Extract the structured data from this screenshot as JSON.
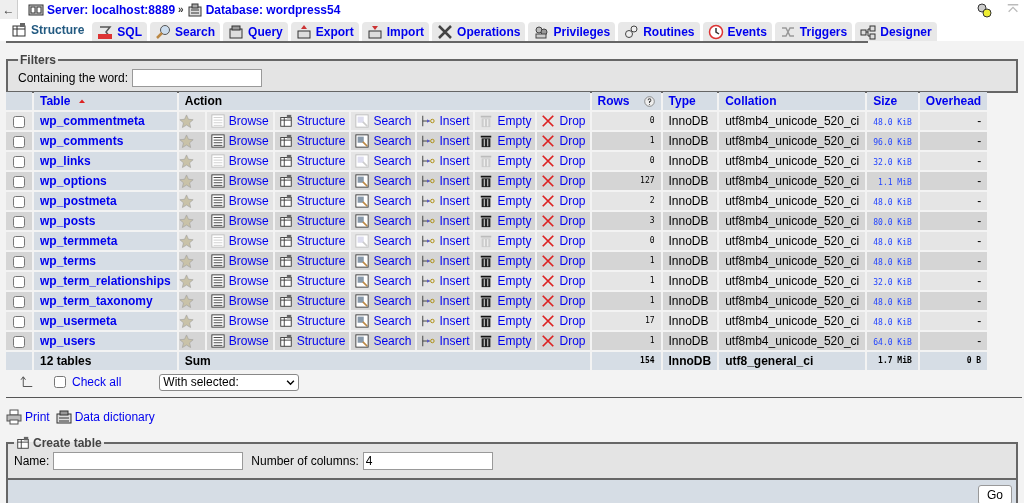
{
  "breadcrumb": [
    {
      "kind": "server",
      "label": "Server: localhost:8889"
    },
    {
      "kind": "database",
      "label": "Database: wordpress54"
    }
  ],
  "breadcrumb_separator": "»",
  "back_button": "←",
  "tabs": [
    {
      "label": "Structure",
      "selected": true
    },
    {
      "label": "SQL",
      "selected": false
    },
    {
      "label": "Search",
      "selected": false
    },
    {
      "label": "Query",
      "selected": false
    },
    {
      "label": "Export",
      "selected": false
    },
    {
      "label": "Import",
      "selected": false
    },
    {
      "label": "Operations",
      "selected": false
    },
    {
      "label": "Privileges",
      "selected": false
    },
    {
      "label": "Routines",
      "selected": false
    },
    {
      "label": "Events",
      "selected": false
    },
    {
      "label": "Triggers",
      "selected": false
    },
    {
      "label": "Designer",
      "selected": false
    }
  ],
  "filters": {
    "legend": "Filters",
    "label": "Containing the word:"
  },
  "table": {
    "columns": [
      "Table",
      "Action",
      "Rows",
      "Type",
      "Collation",
      "Size",
      "Overhead"
    ],
    "rows": [
      {
        "name": "wp_commentmeta",
        "checked": false,
        "has_rows": false,
        "actions": [
          "Browse",
          "Structure",
          "Search",
          "Insert",
          "Empty",
          "Drop"
        ],
        "rows": "0",
        "type": "InnoDB",
        "collation": "utf8mb4_unicode_520_ci",
        "size": "48.0 KiB",
        "overhead": "-"
      },
      {
        "name": "wp_comments",
        "checked": false,
        "has_rows": true,
        "actions": [
          "Browse",
          "Structure",
          "Search",
          "Insert",
          "Empty",
          "Drop"
        ],
        "rows": "1",
        "type": "InnoDB",
        "collation": "utf8mb4_unicode_520_ci",
        "size": "96.0 KiB",
        "overhead": "-"
      },
      {
        "name": "wp_links",
        "checked": false,
        "has_rows": false,
        "actions": [
          "Browse",
          "Structure",
          "Search",
          "Insert",
          "Empty",
          "Drop"
        ],
        "rows": "0",
        "type": "InnoDB",
        "collation": "utf8mb4_unicode_520_ci",
        "size": "32.0 KiB",
        "overhead": "-"
      },
      {
        "name": "wp_options",
        "checked": false,
        "has_rows": true,
        "actions": [
          "Browse",
          "Structure",
          "Search",
          "Insert",
          "Empty",
          "Drop"
        ],
        "rows": "127",
        "type": "InnoDB",
        "collation": "utf8mb4_unicode_520_ci",
        "size": "1.1 MiB",
        "overhead": "-"
      },
      {
        "name": "wp_postmeta",
        "checked": false,
        "has_rows": true,
        "actions": [
          "Browse",
          "Structure",
          "Search",
          "Insert",
          "Empty",
          "Drop"
        ],
        "rows": "2",
        "type": "InnoDB",
        "collation": "utf8mb4_unicode_520_ci",
        "size": "48.0 KiB",
        "overhead": "-"
      },
      {
        "name": "wp_posts",
        "checked": false,
        "has_rows": true,
        "actions": [
          "Browse",
          "Structure",
          "Search",
          "Insert",
          "Empty",
          "Drop"
        ],
        "rows": "3",
        "type": "InnoDB",
        "collation": "utf8mb4_unicode_520_ci",
        "size": "80.0 KiB",
        "overhead": "-"
      },
      {
        "name": "wp_termmeta",
        "checked": false,
        "has_rows": false,
        "actions": [
          "Browse",
          "Structure",
          "Search",
          "Insert",
          "Empty",
          "Drop"
        ],
        "rows": "0",
        "type": "InnoDB",
        "collation": "utf8mb4_unicode_520_ci",
        "size": "48.0 KiB",
        "overhead": "-"
      },
      {
        "name": "wp_terms",
        "checked": false,
        "has_rows": true,
        "actions": [
          "Browse",
          "Structure",
          "Search",
          "Insert",
          "Empty",
          "Drop"
        ],
        "rows": "1",
        "type": "InnoDB",
        "collation": "utf8mb4_unicode_520_ci",
        "size": "48.0 KiB",
        "overhead": "-"
      },
      {
        "name": "wp_term_relationships",
        "checked": false,
        "has_rows": true,
        "actions": [
          "Browse",
          "Structure",
          "Search",
          "Insert",
          "Empty",
          "Drop"
        ],
        "rows": "1",
        "type": "InnoDB",
        "collation": "utf8mb4_unicode_520_ci",
        "size": "32.0 KiB",
        "overhead": "-"
      },
      {
        "name": "wp_term_taxonomy",
        "checked": false,
        "has_rows": true,
        "actions": [
          "Browse",
          "Structure",
          "Search",
          "Insert",
          "Empty",
          "Drop"
        ],
        "rows": "1",
        "type": "InnoDB",
        "collation": "utf8mb4_unicode_520_ci",
        "size": "48.0 KiB",
        "overhead": "-"
      },
      {
        "name": "wp_usermeta",
        "checked": false,
        "has_rows": true,
        "actions": [
          "Browse",
          "Structure",
          "Search",
          "Insert",
          "Empty",
          "Drop"
        ],
        "rows": "17",
        "type": "InnoDB",
        "collation": "utf8mb4_unicode_520_ci",
        "size": "48.0 KiB",
        "overhead": "-"
      },
      {
        "name": "wp_users",
        "checked": false,
        "has_rows": true,
        "actions": [
          "Browse",
          "Structure",
          "Search",
          "Insert",
          "Empty",
          "Drop"
        ],
        "rows": "1",
        "type": "InnoDB",
        "collation": "utf8mb4_unicode_520_ci",
        "size": "64.0 KiB",
        "overhead": "-"
      }
    ],
    "footer": {
      "count": "12 tables",
      "action": "Sum",
      "rows": "154",
      "type": "InnoDB",
      "collation": "utf8_general_ci",
      "size": "1.7 MiB",
      "overhead": "0 B"
    }
  },
  "check_all": {
    "label": "Check all",
    "checked": false
  },
  "with_selected": "With selected:",
  "links": [
    {
      "kind": "print",
      "label": "Print"
    },
    {
      "kind": "dictionary",
      "label": "Data dictionary"
    }
  ],
  "create_table": {
    "legend": "Create table",
    "name_label": "Name:",
    "columns_label": "Number of columns:",
    "columns_value": "4",
    "button": "Go"
  }
}
